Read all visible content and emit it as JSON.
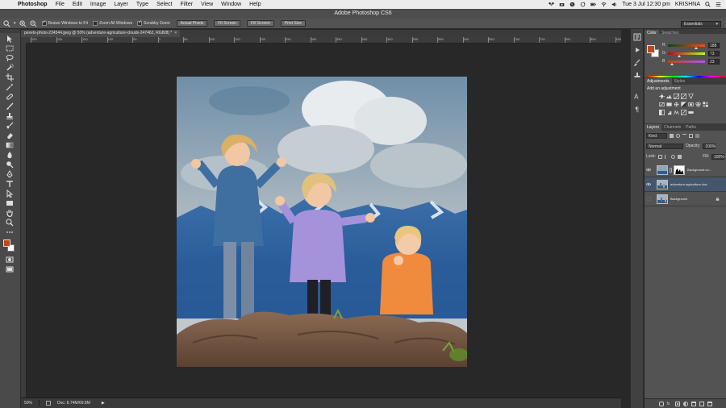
{
  "menubar": {
    "app": "Photoshop",
    "menus": [
      "File",
      "Edit",
      "Image",
      "Layer",
      "Type",
      "Select",
      "Filter",
      "View",
      "Window",
      "Help"
    ],
    "clock": "Tue 3 Jul  12:30 pm",
    "user": "KRISHNA"
  },
  "window": {
    "title": "Adobe Photoshop CS6"
  },
  "options": {
    "resize_windows": "Resize Windows to Fit",
    "zoom_all": "Zoom All Windows",
    "scrubby_zoom": "Scrubby Zoom",
    "actual_pixels": "Actual Pixels",
    "fit_screen": "Fit Screen",
    "fill_screen": "Fill Screen",
    "print_size": "Print Size",
    "workspace": "Essentials"
  },
  "document": {
    "tab_title": "pexels-photo-234544.jpeg @ 50% (adventure-agriculture-clouds-247462, RGB/8) *",
    "close": "×",
    "zoom": "50%",
    "doc_info": "Doc: 8.74M/69.8M"
  },
  "ruler": {
    "ticks": [
      "250",
      "200",
      "150",
      "100",
      "50",
      "0",
      "50",
      "100",
      "150",
      "200",
      "250",
      "300",
      "350",
      "400",
      "450",
      "500",
      "550",
      "600",
      "650",
      "700",
      "750",
      "800",
      "850",
      "900",
      "950",
      "1000"
    ]
  },
  "panels": {
    "color_tabs": [
      "Color",
      "Swatches"
    ],
    "rgb": {
      "r_label": "R",
      "g_label": "G",
      "b_label": "B",
      "r": "188",
      "g": "73",
      "b": "23"
    },
    "fg_color": "#bc4917",
    "bg_color": "#ffffff",
    "adj_tabs": [
      "Adjustments",
      "Styles"
    ],
    "adj_title": "Add an adjustment",
    "layers_tabs": [
      "Layers",
      "Channels",
      "Paths"
    ],
    "kind": "Kind",
    "blend": "Normal",
    "opacity_label": "Opacity:",
    "opacity": "100%",
    "lock_label": "Lock:",
    "fill_label": "Fill:",
    "fill": "100%",
    "layers": [
      {
        "name": "Background co...",
        "has_mask": true,
        "visible": true,
        "selected": false
      },
      {
        "name": "adventure-agriculture-cloud...",
        "has_mask": false,
        "visible": true,
        "selected": true
      },
      {
        "name": "Background",
        "has_mask": false,
        "visible": false,
        "selected": false,
        "locked": true
      }
    ]
  }
}
